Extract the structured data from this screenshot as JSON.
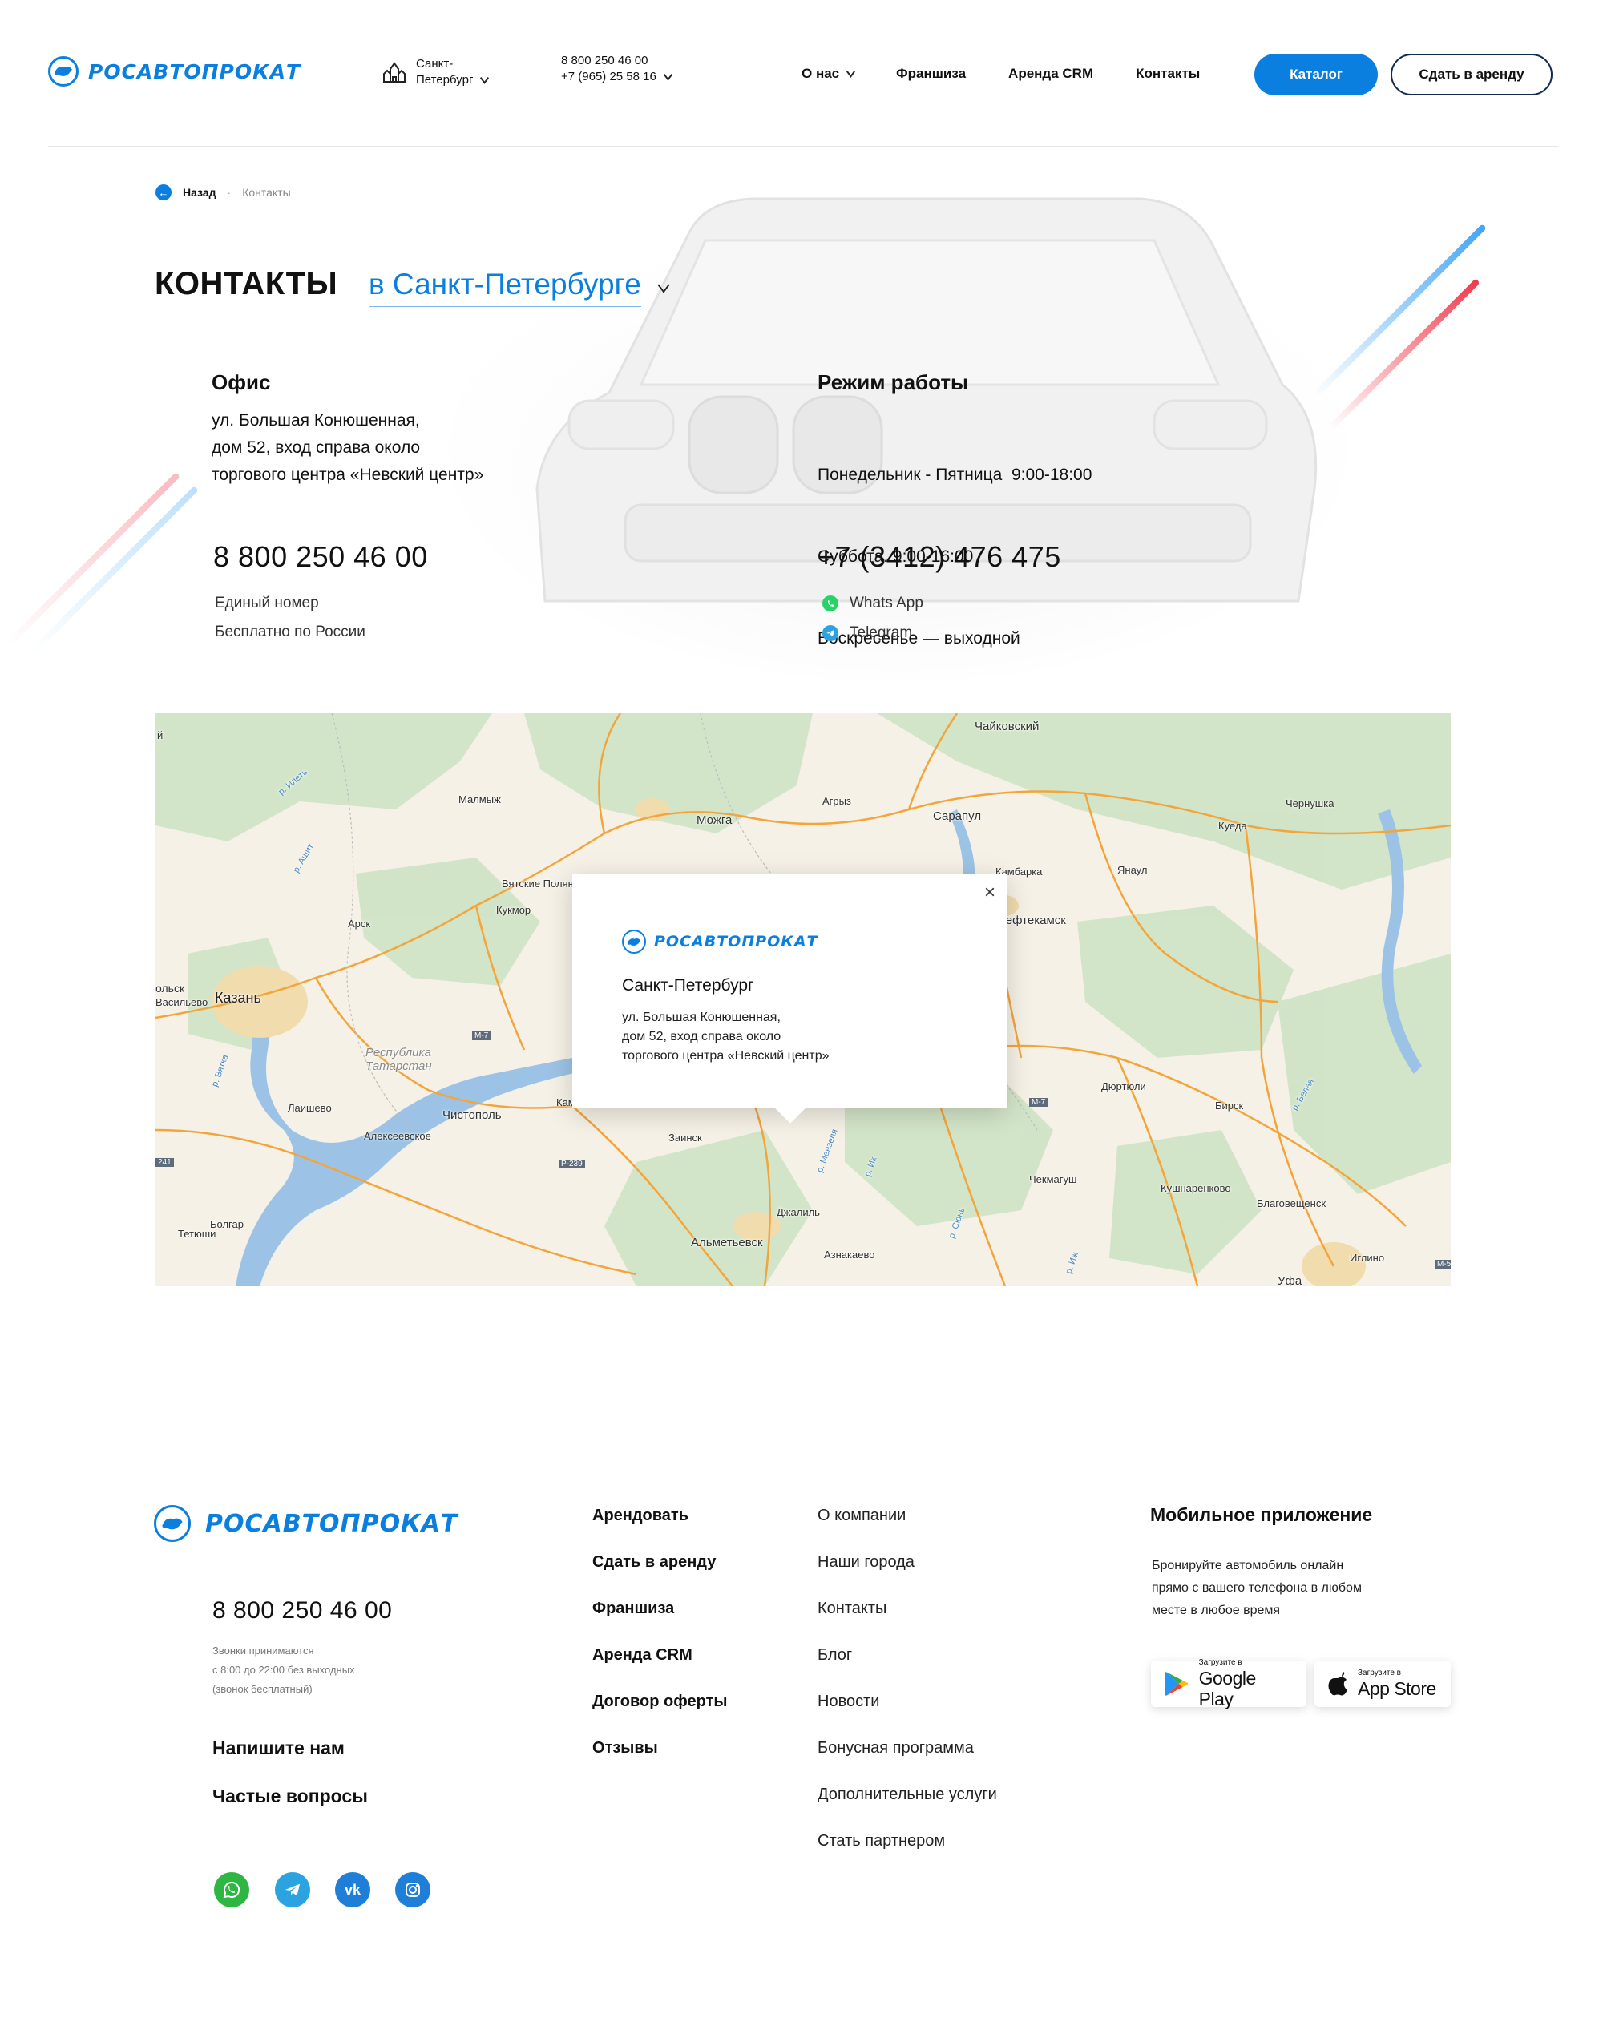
{
  "header": {
    "logo_text": "РОСАВТОПРОКАТ",
    "city": "Санкт-\nПетербург",
    "city_line1": "Санкт-",
    "city_line2": "Петербург",
    "phone1": "8 800 250 46 00",
    "phone2": "+7 (965) 25 58 16",
    "nav": [
      "О нас",
      "Франшиза",
      "Аренда CRM",
      "Контакты"
    ],
    "catalog_button": "Каталог",
    "rent_out_button": "Сдать в аренду"
  },
  "breadcrumb": {
    "back": "Назад",
    "separator": "·",
    "current": "Контакты"
  },
  "contacts": {
    "title": "КОНТАКТЫ",
    "city_select": "в Санкт-Петербурге",
    "office_heading": "Офис",
    "office_address": [
      "ул. Большая Конюшенная,",
      "дом 52, вход справа около",
      "торгового центра «Невский центр»"
    ],
    "hours_heading": "Режим работы",
    "hours": [
      "Понедельник - Пятница  9:00-18:00",
      "Суббота. 9:00-16:00",
      "Воскресенье — выходной"
    ],
    "phone_main": "8 800 250 46 00",
    "phone_main_note1": "Единый номер",
    "phone_main_note2": "Бесплатно по России",
    "phone_local": "+7 (3412) 476 475",
    "messenger1": "Whats App",
    "messenger2": "Telegram"
  },
  "map": {
    "labels": {
      "chaykovsky": "Чайковский",
      "malmyzh": "Малмыж",
      "mozhga": "Можга",
      "agryz": "Агрыз",
      "sarapul": "Сарапул",
      "kueda": "Куеда",
      "chernushka": "Чернушка",
      "kambarka": "Камбарка",
      "yanaul": "Янаул",
      "vyatskie": "Вятские Поляны",
      "kukmor": "Кукмор",
      "arsk": "Арск",
      "neftekamsk": "Нефтекамск",
      "kazan": "Казань",
      "zelenodolsk": "ольск",
      "vasilyevo": "Васильево",
      "tatarstan": "Республика\nТатарстан",
      "tatarstan1": "Республика",
      "tatarstan2": "Татарстан",
      "laishevo": "Лаишево",
      "chistopol": "Чистополь",
      "alekseevskoe": "Алексеевское",
      "kam": "Кам",
      "zainsk": "Заинск",
      "dyurtyuli": "Дюртюли",
      "birsk": "Бирск",
      "chekmagush": "Чекмагуш",
      "kushnarenkovo": "Кушнаренково",
      "blagoveshchensk": "Благовещенск",
      "dzhalil": "Джалиль",
      "almetyevsk": "Альметьевск",
      "aznakaevo": "Азнакаево",
      "iglino": "Иглино",
      "ufa": "Уфа",
      "bolgar": "Болгар",
      "tetyushi": "Тетюши",
      "m7a": "М-7",
      "m7b": "М-7",
      "r239": "Р-239",
      "r241": "241",
      "m5": "М-5",
      "ik": "р. Ик",
      "vyatka": "р. Вятка",
      "belaya": "р. Белая",
      "ij": "р. Иж",
      "ilet": "р. Илеть",
      "ashit": "р. Ашит",
      "menzelya": "р. Мензеля",
      "syun": "р. Сюнь",
      "kaz": "Каз",
      "kazanka": "й"
    },
    "popup": {
      "logo_text": "РОСАВТОПРОКАТ",
      "city": "Санкт-Петербург",
      "address": [
        "ул. Большая Конюшенная,",
        "дом 52, вход справа около",
        "торгового центра «Невский центр»"
      ],
      "close": "×"
    }
  },
  "footer": {
    "logo_text": "РОСАВТОПРОКАТ",
    "phone": "8 800 250 46 00",
    "phone_note": [
      "Звонки принимаются",
      "с 8:00 до 22:00 без выходных",
      "(звонок бесплатный)"
    ],
    "write_us": "Напишите нам",
    "faq": "Частые вопросы",
    "col1": [
      "Арендовать",
      "Сдать в аренду",
      "Франшиза",
      "Аренда CRM",
      "Договор оферты",
      "Отзывы"
    ],
    "col2": [
      "О компании",
      "Наши города",
      "Контакты",
      "Блог",
      "Новости",
      "Бонусная программа",
      "Дополнительные услуги",
      "Стать партнером"
    ],
    "app_heading": "Мобильное приложение",
    "app_text": [
      "Бронируйте автомобиль онлайн",
      "прямо с вашего телефона в любом",
      "месте в любое время"
    ],
    "google_small": "Загрузите в",
    "google_big": "Google Play",
    "apple_small": "Загрузите в",
    "apple_big": "App Store",
    "social_vk": "vk"
  },
  "colors": {
    "accent": "#0b7fe0",
    "dark_blue": "#0f2a55",
    "stripe_blue": "#42a5f5",
    "stripe_red": "#f0394b",
    "whatsapp": "#25d366",
    "telegram": "#2aa3e0"
  }
}
